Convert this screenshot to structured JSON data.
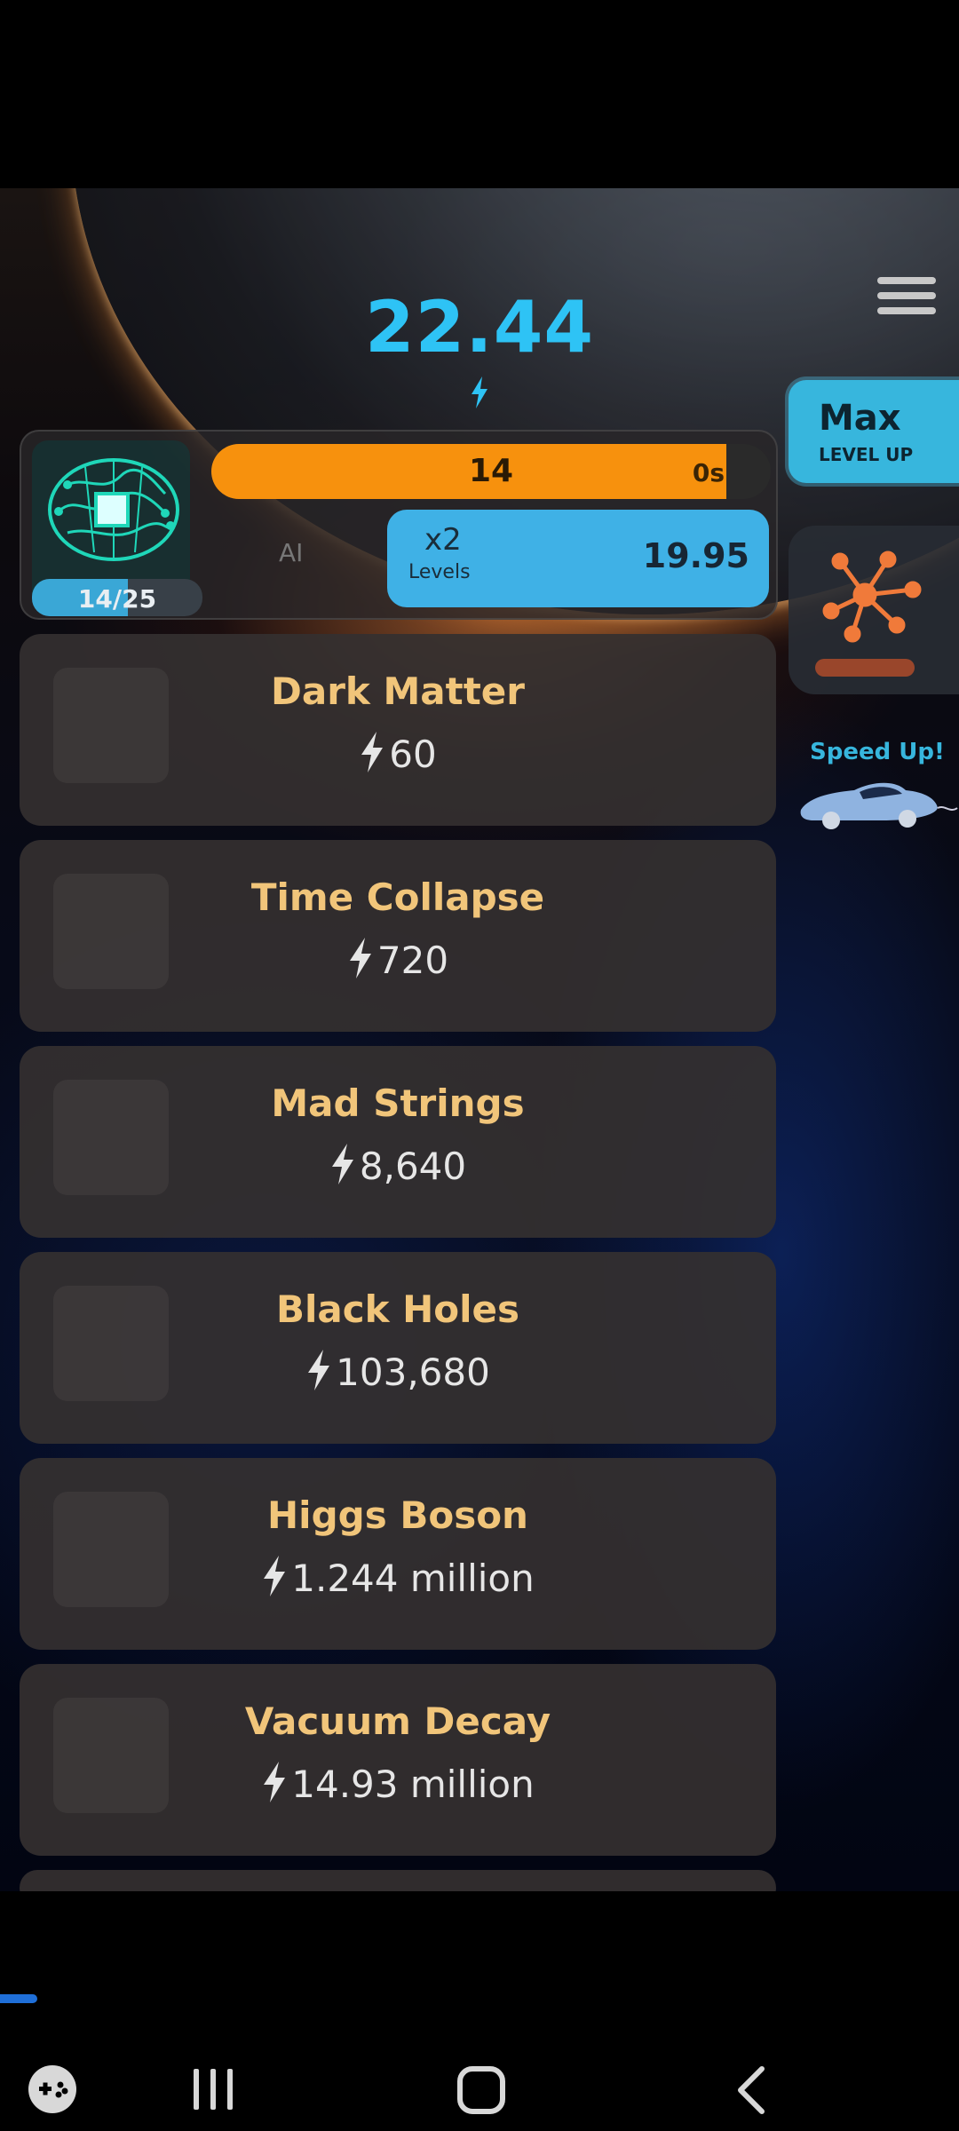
{
  "header": {
    "score": "22.44",
    "menu_icon": "hamburger-menu-icon"
  },
  "max_button": {
    "title": "Max",
    "subtitle": "LEVEL UP"
  },
  "ai_panel": {
    "brain_count": "14/25",
    "brain_progress": 0.56,
    "ai_label": "AI",
    "level": "14",
    "level_progress": 0.92,
    "time_left": "0s",
    "multiplier": "x2",
    "multiplier_unit": "Levels",
    "price": "19.95",
    "brain_icon": "circuit-brain-icon"
  },
  "side": {
    "network_icon": "network-graph-icon",
    "speed_up_label": "Speed Up!",
    "car_icon": "flying-car-icon"
  },
  "upgrades": [
    {
      "name": "Dark Matter",
      "cost": "60"
    },
    {
      "name": "Time Collapse",
      "cost": "720"
    },
    {
      "name": "Mad Strings",
      "cost": "8,640"
    },
    {
      "name": "Black Holes",
      "cost": "103,680"
    },
    {
      "name": "Higgs Boson",
      "cost": "1.244 million"
    },
    {
      "name": "Vacuum Decay",
      "cost": "14.93 million"
    }
  ],
  "colors": {
    "score": "#2ec3f5",
    "accent_blue": "#3fb1e6",
    "accent_orange": "#f7910d",
    "upgrade_name": "#f1c57a"
  },
  "system_nav": {
    "game_icon": "game-controller-icon",
    "recents_icon": "recents-icon",
    "home_icon": "home-icon",
    "back_icon": "back-icon"
  }
}
